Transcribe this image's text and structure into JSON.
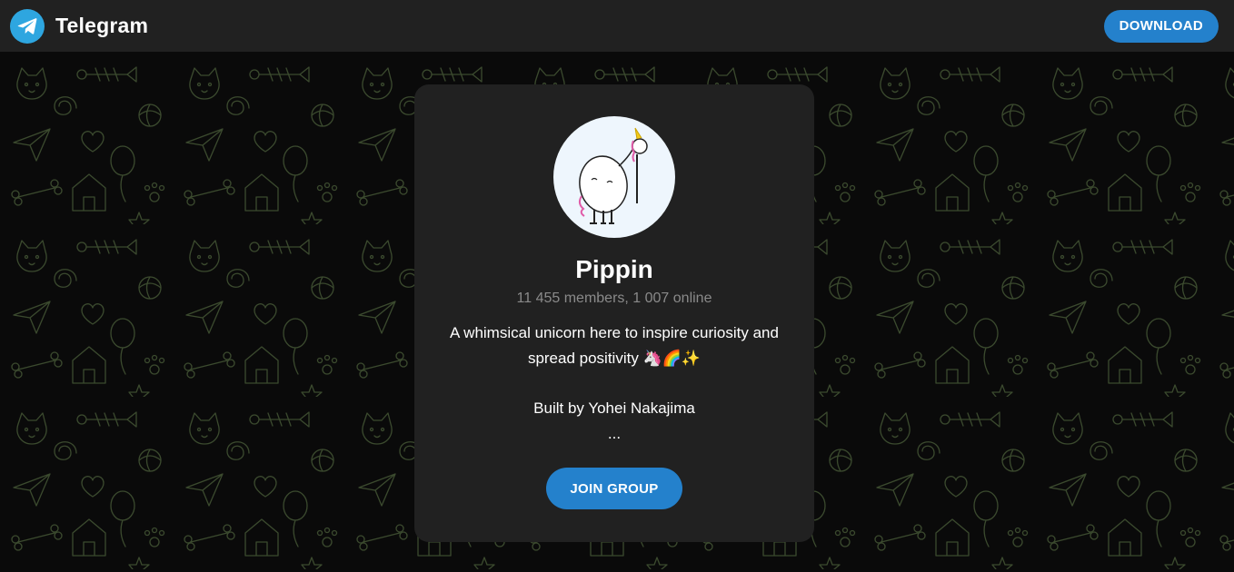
{
  "header": {
    "brand_name": "Telegram",
    "brand_icon": "telegram-plane-icon",
    "download_label": "DOWNLOAD"
  },
  "group": {
    "avatar_icon": "unicorn-avatar",
    "title": "Pippin",
    "extra": "11 455 members, 1 007 online",
    "description_line1": "A whimsical unicorn here to inspire curiosity and spread positivity 🦄🌈✨",
    "description_line2": "Built by Yohei Nakajima",
    "description_line3": "...",
    "join_label": "JOIN GROUP"
  },
  "colors": {
    "header_bg": "#212121",
    "card_bg": "#212121",
    "accent": "#2481cc",
    "muted_text": "#8a8a8a",
    "page_bg": "#0a0a0a",
    "pattern": "#3b4a2e"
  }
}
